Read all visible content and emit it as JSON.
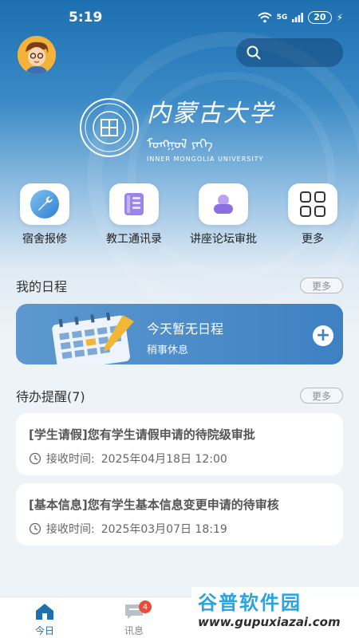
{
  "status": {
    "time": "5:19",
    "network": "5G",
    "battery": "20"
  },
  "header": {
    "logo_cn": "内蒙古大学",
    "logo_mn": "ᠮᠣᠩᠭᠣᠯ ᠶᠡᠬᠡ",
    "logo_en": "INNER MONGOLIA UNIVERSITY",
    "seal_ring": "INNER MONGOLIA UNIVERSITY"
  },
  "apps": [
    {
      "label": "宿舍报修",
      "icon": "wrench-icon"
    },
    {
      "label": "教工通讯录",
      "icon": "address-book-icon"
    },
    {
      "label": "讲座论坛审批",
      "icon": "approval-icon"
    },
    {
      "label": "更多",
      "icon": "grid-icon"
    }
  ],
  "schedule": {
    "title": "我的日程",
    "more": "更多",
    "empty_title": "今天暂无日程",
    "empty_sub": "稍事休息"
  },
  "todo": {
    "title": "待办提醒(7)",
    "more": "更多",
    "items": [
      {
        "title": "[学生请假]您有学生请假申请的待院级审批",
        "time_label": "接收时间:",
        "time": "2025年04月18日 12:00"
      },
      {
        "title": "[基本信息]您有学生基本信息变更申请的待审核",
        "time_label": "接收时间:",
        "time": "2025年03月07日 18:19"
      }
    ]
  },
  "tabbar": {
    "tabs": [
      {
        "label": "今日",
        "active": true
      },
      {
        "label": "讯息",
        "badge": "4"
      }
    ]
  },
  "watermark": {
    "cn": "谷普软件园",
    "url": "www.gupuxiazai.com"
  },
  "colors": {
    "primary": "#1d6fb0",
    "accent_blue": "#3d81c3",
    "badge_red": "#e74c3c"
  }
}
